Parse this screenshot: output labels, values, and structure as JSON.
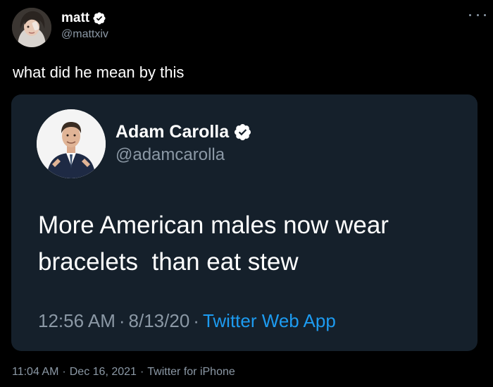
{
  "tweet": {
    "author": {
      "display_name": "matt",
      "handle": "@mattxiv",
      "verified": true
    },
    "text": "what did he mean by this",
    "timestamp": {
      "time": "11:04 AM",
      "separator": "·",
      "date": "Dec 16, 2021",
      "source": "Twitter for iPhone"
    }
  },
  "quoted_tweet": {
    "author": {
      "display_name": "Adam Carolla",
      "handle": "@adamcarolla",
      "verified": true
    },
    "text": "More American males now wear bracelets  than eat stew",
    "timestamp": {
      "time": "12:56 AM",
      "separator": "·",
      "date": "8/13/20",
      "source": "Twitter Web App"
    }
  },
  "icons": {
    "more": "more-horizontal-icon",
    "verified": "verified-badge-icon"
  },
  "colors": {
    "background": "#000000",
    "card": "#15202b",
    "text_primary": "#ffffff",
    "text_secondary": "#8b98a5",
    "link": "#1d9bf0",
    "verified": "#ffffff"
  }
}
